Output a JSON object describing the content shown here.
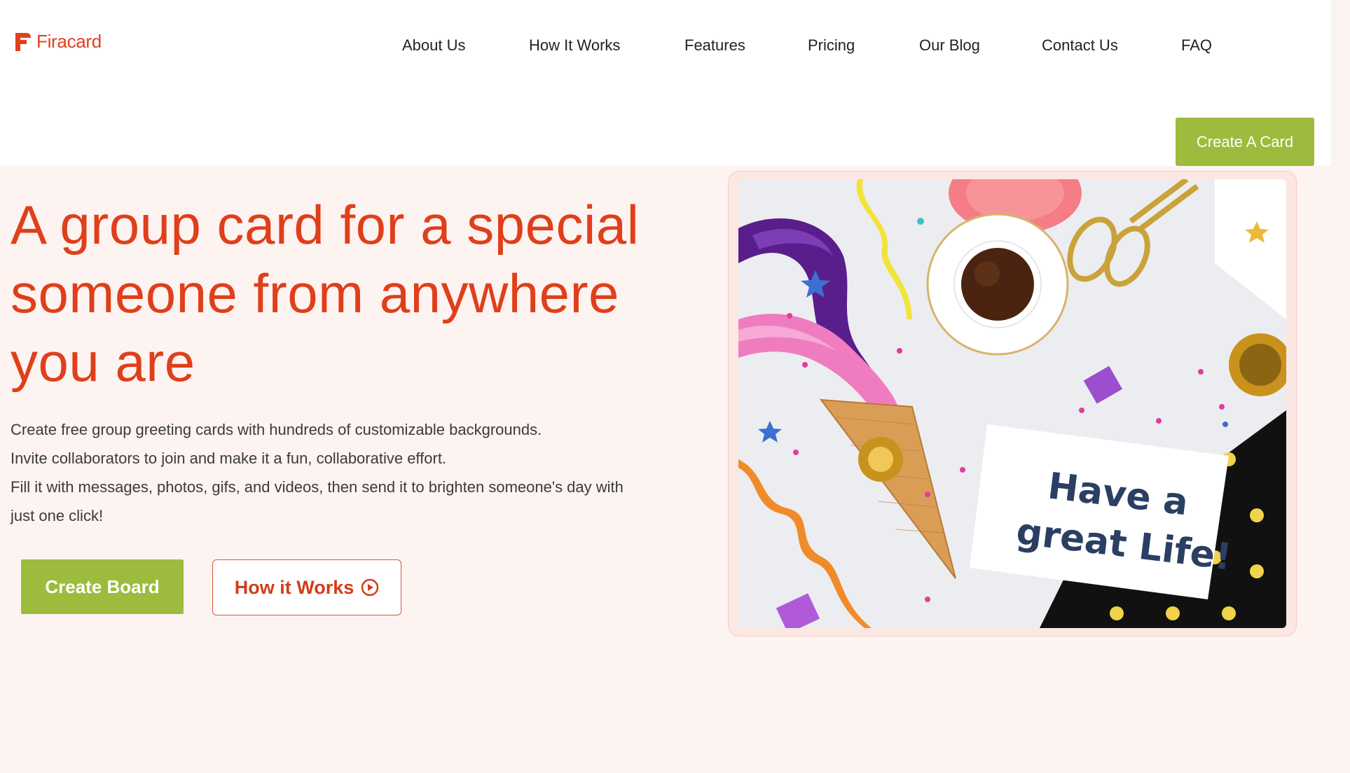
{
  "brand": {
    "name": "Firacard",
    "color": "#e2401c"
  },
  "nav": {
    "items": [
      {
        "label": "About Us"
      },
      {
        "label": "How It Works"
      },
      {
        "label": "Features"
      },
      {
        "label": "Pricing"
      },
      {
        "label": "Our Blog"
      },
      {
        "label": "Contact Us"
      },
      {
        "label": "FAQ"
      }
    ],
    "cta_label": "Create A Card"
  },
  "hero": {
    "title": "A group card for a special someone from anywhere you are",
    "description": [
      "Create free group greeting cards with hundreds of customizable backgrounds.",
      "Invite collaborators to join and make it a fun, collaborative effort.",
      "Fill it with messages, photos, gifs, and videos, then send it to brighten someone's day with just one click!"
    ],
    "primary_button": "Create Board",
    "secondary_button": "How it Works",
    "image_card_text": "Have a great Life!"
  },
  "colors": {
    "accent": "#e2401c",
    "green": "#9dbb3c",
    "hero_bg": "#fdf3f1",
    "text": "#3b3b3b"
  },
  "icons": [
    "play-circle-icon",
    "firacard-logo-icon"
  ]
}
